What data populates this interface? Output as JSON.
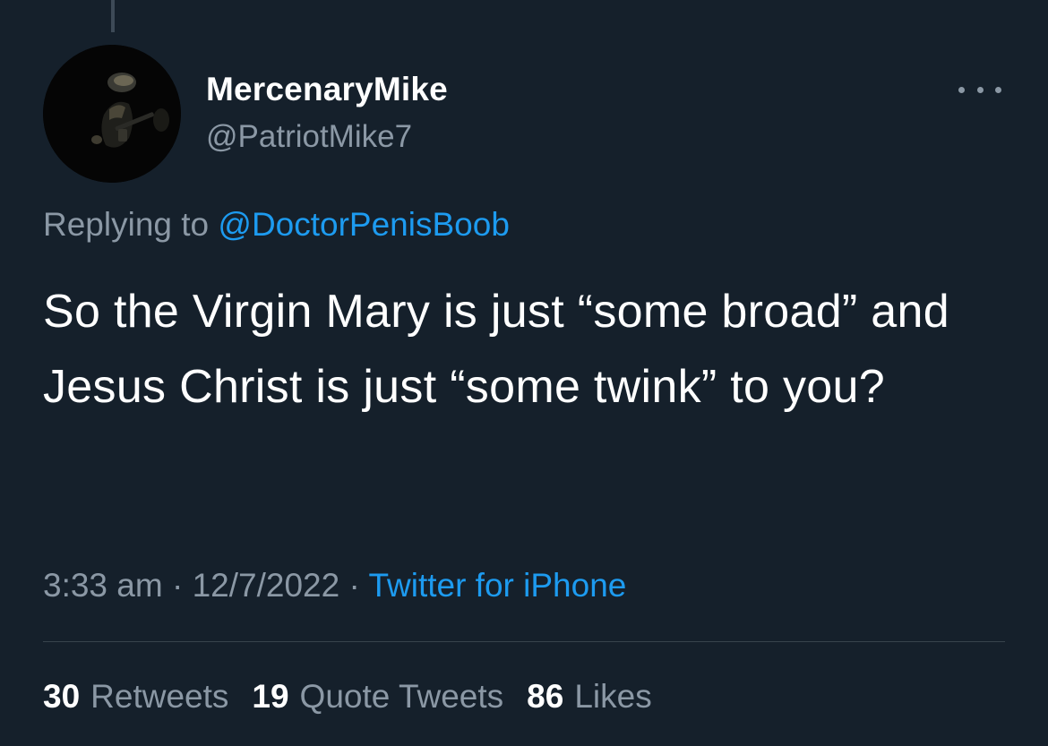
{
  "tweet": {
    "author": {
      "display_name": "MercenaryMike",
      "handle": "@PatriotMike7"
    },
    "replying_label": "Replying to",
    "replying_to": "@DoctorPenisBoob",
    "text": "So the Virgin Mary is just “some broad” and Jesus Christ is just “some twink” to you?",
    "time": "3:33 am",
    "separator": "·",
    "date": "12/7/2022",
    "source": "Twitter for iPhone",
    "stats": {
      "retweets_count": "30",
      "retweets_label": "Retweets",
      "quotes_count": "19",
      "quotes_label": "Quote Tweets",
      "likes_count": "86",
      "likes_label": "Likes"
    }
  },
  "icons": {
    "more": "more-horizontal-icon"
  },
  "colors": {
    "background": "#15202b",
    "text_primary": "#ffffff",
    "text_secondary": "#8b98a5",
    "link": "#1d9bf0",
    "divider": "#38444d"
  }
}
